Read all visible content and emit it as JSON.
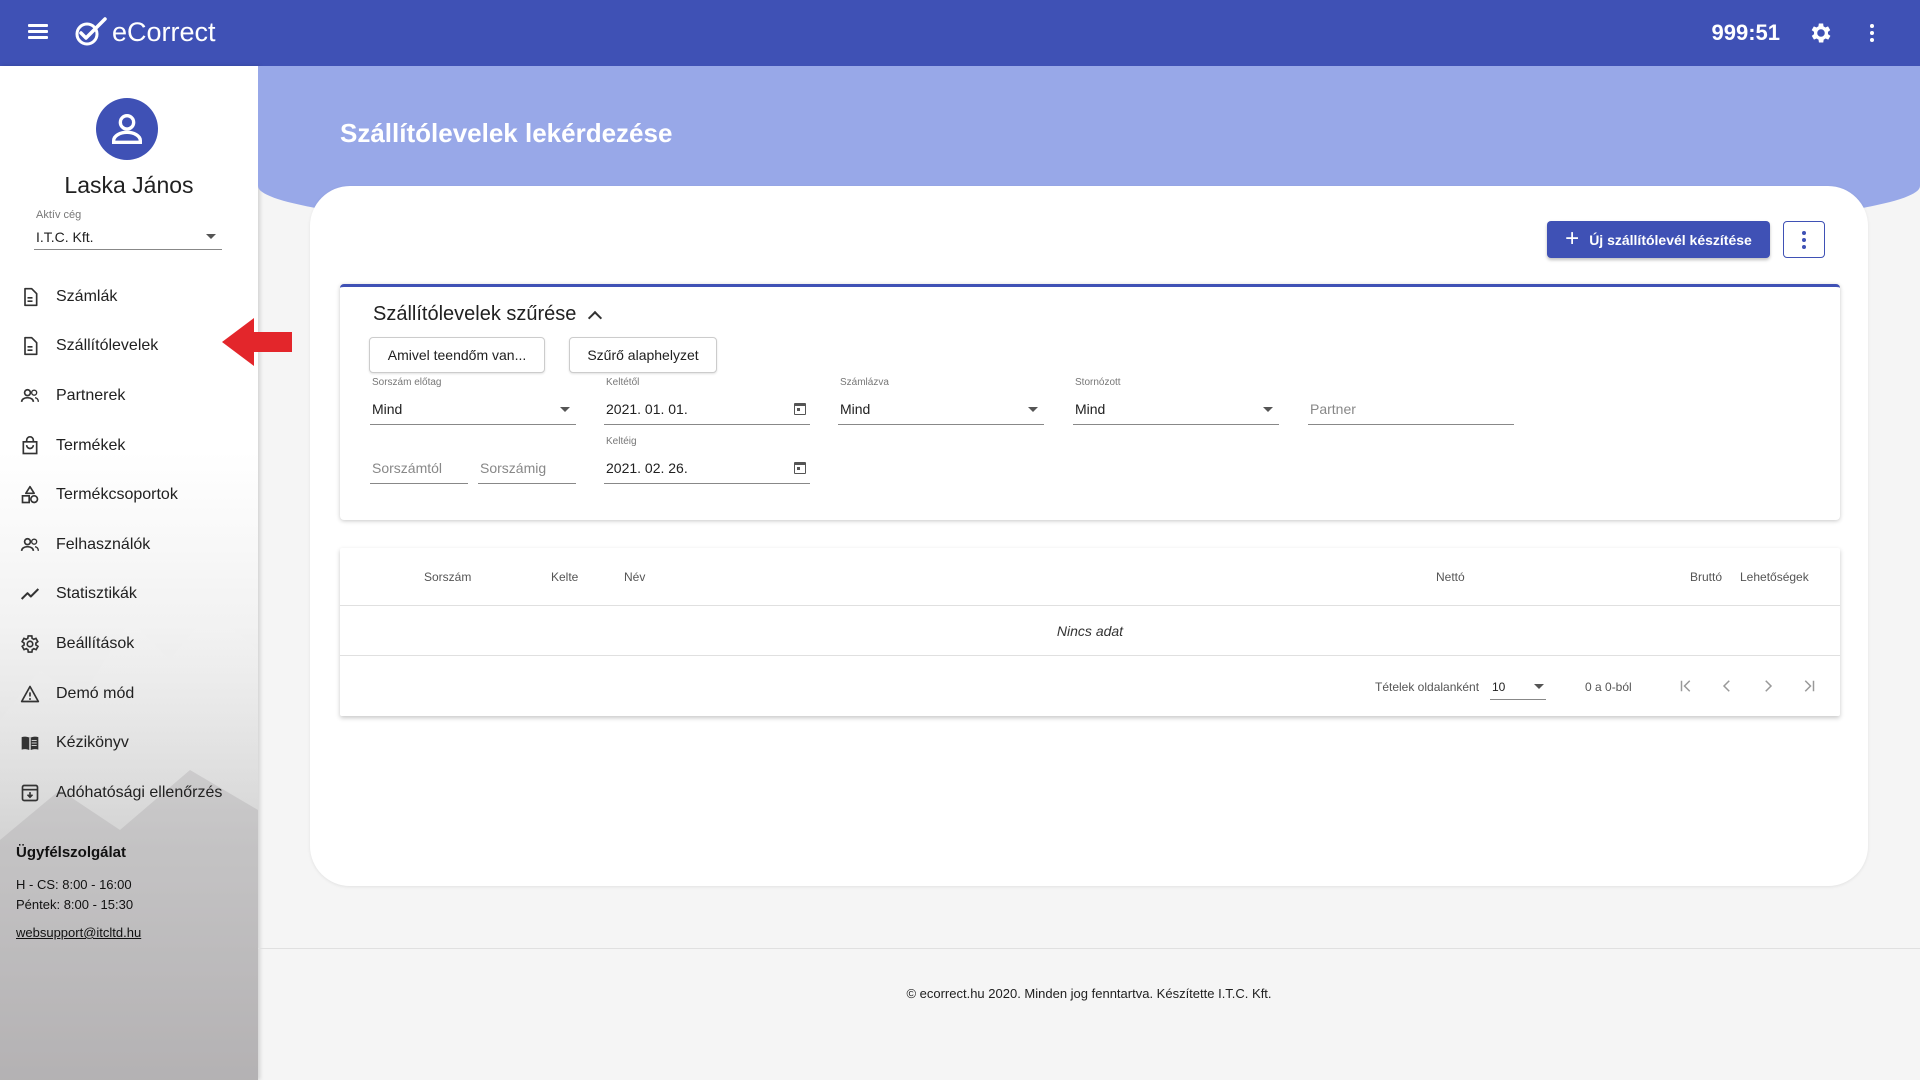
{
  "app": {
    "name": "eCorrect",
    "timer": "999:51"
  },
  "colors": {
    "primary": "#3f51b5",
    "hero": "#98a8e8",
    "arrow": "#e3262b"
  },
  "icons": {
    "menu": "hamburger-menu-icon",
    "settings": "gear-icon",
    "more": "kebab-icon",
    "avatar": "account-circle-icon",
    "arrow": "red-arrow-icon"
  },
  "user": {
    "name": "Laska János",
    "company_label": "Aktív cég",
    "company": "I.T.C. Kft."
  },
  "nav": [
    {
      "label": "Számlák",
      "icon": "document-icon"
    },
    {
      "label": "Szállítólevelek",
      "icon": "document-icon"
    },
    {
      "label": "Partnerek",
      "icon": "people-icon"
    },
    {
      "label": "Termékek",
      "icon": "shopping-bag-icon"
    },
    {
      "label": "Termékcsoportok",
      "icon": "category-icon"
    },
    {
      "label": "Felhasználók",
      "icon": "people-icon"
    },
    {
      "label": "Statisztikák",
      "icon": "trending-line-icon"
    },
    {
      "label": "Beállítások",
      "icon": "gear-icon"
    },
    {
      "label": "Demó mód",
      "icon": "warning-icon"
    },
    {
      "label": "Kézikönyv",
      "icon": "book-icon"
    },
    {
      "label": "Adóhatósági ellenőrzés",
      "icon": "archive-icon"
    }
  ],
  "support": {
    "title": "Ügyfélszolgálat",
    "hours1": "H - CS: 8:00 - 16:00",
    "hours2": "Péntek: 8:00 - 15:30",
    "email": "websupport@itcltd.hu"
  },
  "page": {
    "title": "Szállítólevelek lekérdezése",
    "new_button": "Új szállítólevél készítése"
  },
  "filter": {
    "title": "Szállítólevelek szűrése",
    "btn_todo": "Amivel teendőm van...",
    "btn_reset": "Szűrő alaphelyzet",
    "prefix_label": "Sorszám előtag",
    "prefix_value": "Mind",
    "from_date_label": "Keltétől",
    "from_date_value": "2021. 01. 01.",
    "invoiced_label": "Számlázva",
    "invoiced_value": "Mind",
    "cancelled_label": "Stornózott",
    "cancelled_value": "Mind",
    "partner_placeholder": "Partner",
    "serial_from_placeholder": "Sorszámtól",
    "serial_to_placeholder": "Sorszámig",
    "to_date_label": "Keltéig",
    "to_date_value": "2021. 02. 26."
  },
  "table": {
    "columns": [
      "Sorszám",
      "Kelte",
      "Név",
      "Nettó",
      "Bruttó",
      "Lehetőségek"
    ],
    "empty": "Nincs adat",
    "per_page_label": "Tételek oldalanként",
    "per_page_value": "10",
    "range": "0 a 0-ból"
  },
  "footer": {
    "text": "© ecorrect.hu 2020. Minden jog fenntartva. Készítette I.T.C. Kft."
  }
}
